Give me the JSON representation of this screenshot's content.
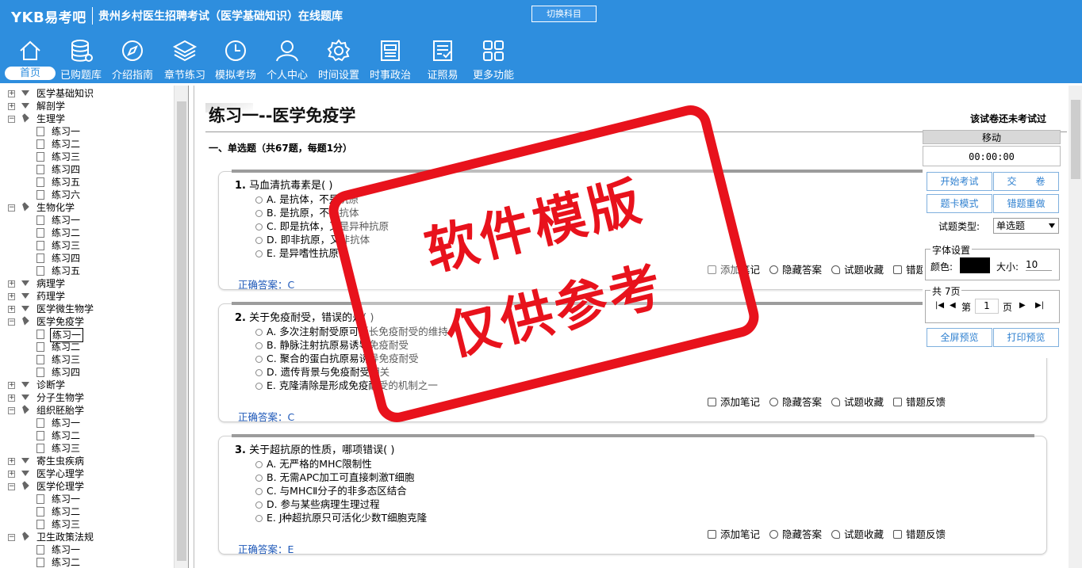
{
  "header": {
    "logo_prefix": "YKB",
    "logo_suffix": "易考吧",
    "title": "贵州乡村医生招聘考试（医学基础知识）在线题库",
    "switch_label": "切换科目"
  },
  "nav": [
    {
      "label": "首页",
      "icon": "home-icon"
    },
    {
      "label": "已购题库",
      "icon": "database-icon"
    },
    {
      "label": "介绍指南",
      "icon": "compass-icon"
    },
    {
      "label": "章节练习",
      "icon": "layers-icon"
    },
    {
      "label": "模拟考场",
      "icon": "clock-icon"
    },
    {
      "label": "个人中心",
      "icon": "user-icon"
    },
    {
      "label": "时间设置",
      "icon": "gear-icon"
    },
    {
      "label": "时事政治",
      "icon": "newspaper-icon"
    },
    {
      "label": "证照易",
      "icon": "checklist-icon"
    },
    {
      "label": "更多功能",
      "icon": "grid-icon"
    }
  ],
  "tree": [
    {
      "t": "医学基础知识",
      "type": "folder"
    },
    {
      "t": "解剖学",
      "type": "folder"
    },
    {
      "t": "生理学",
      "type": "open"
    },
    {
      "t": "练习一",
      "type": "leaf"
    },
    {
      "t": "练习二",
      "type": "leaf"
    },
    {
      "t": "练习三",
      "type": "leaf"
    },
    {
      "t": "练习四",
      "type": "leaf"
    },
    {
      "t": "练习五",
      "type": "leaf"
    },
    {
      "t": "练习六",
      "type": "leaf"
    },
    {
      "t": "生物化学",
      "type": "open"
    },
    {
      "t": "练习一",
      "type": "leaf"
    },
    {
      "t": "练习二",
      "type": "leaf"
    },
    {
      "t": "练习三",
      "type": "leaf"
    },
    {
      "t": "练习四",
      "type": "leaf"
    },
    {
      "t": "练习五",
      "type": "leaf"
    },
    {
      "t": "病理学",
      "type": "folder"
    },
    {
      "t": "药理学",
      "type": "folder"
    },
    {
      "t": "医学微生物学",
      "type": "folder"
    },
    {
      "t": "医学免疫学",
      "type": "open"
    },
    {
      "t": "练习一",
      "type": "sel"
    },
    {
      "t": "练习二",
      "type": "leaf"
    },
    {
      "t": "练习三",
      "type": "leaf"
    },
    {
      "t": "练习四",
      "type": "leaf"
    },
    {
      "t": "诊断学",
      "type": "folder"
    },
    {
      "t": "分子生物学",
      "type": "folder"
    },
    {
      "t": "组织胚胎学",
      "type": "open"
    },
    {
      "t": "练习一",
      "type": "leaf"
    },
    {
      "t": "练习二",
      "type": "leaf"
    },
    {
      "t": "练习三",
      "type": "leaf"
    },
    {
      "t": "寄生虫疾病",
      "type": "folder"
    },
    {
      "t": "医学心理学",
      "type": "folder"
    },
    {
      "t": "医学伦理学",
      "type": "open"
    },
    {
      "t": "练习一",
      "type": "leaf"
    },
    {
      "t": "练习二",
      "type": "leaf"
    },
    {
      "t": "练习三",
      "type": "leaf"
    },
    {
      "t": "卫生政策法规",
      "type": "open"
    },
    {
      "t": "练习一",
      "type": "leaf"
    },
    {
      "t": "练习二",
      "type": "leaf"
    }
  ],
  "paper": {
    "title": "练习一--医学免疫学",
    "status": "该试卷还未考试过",
    "section": "一、单选题（共67题，每题1分）"
  },
  "questions": [
    {
      "num": "1.",
      "stem": "马血清抗毒素是(  )",
      "options": [
        "A. 是抗体，不是抗原",
        "B. 是抗原，不是抗体",
        "C. 即是抗体，又是异种抗原",
        "D. 即非抗原，又非抗体",
        "E. 是异嗜性抗原"
      ],
      "answer": "正确答案：C"
    },
    {
      "num": "2.",
      "stem": "关于免疫耐受，错误的是(  )",
      "options": [
        "A. 多次注射耐受原可延长免疫耐受的维持",
        "B. 静脉注射抗原易诱导免疫耐受",
        "C. 聚合的蛋白抗原易诱导免疫耐受",
        "D. 遗传背景与免疫耐受相关",
        "E. 克隆清除是形成免疫耐受的机制之一"
      ],
      "answer": "正确答案：C"
    },
    {
      "num": "3.",
      "stem": "关于超抗原的性质，哪项错误(  )",
      "options": [
        "A. 无严格的MHC限制性",
        "B. 无需APC加工可直接刺激T细胞",
        "C. 与MHCⅡ分子的非多态区结合",
        "D. 参与某些病理生理过程",
        "E. J种超抗原只可活化少数T细胞克隆"
      ],
      "answer": "正确答案：E"
    }
  ],
  "tools": {
    "note": "添加笔记",
    "hide": "隐藏答案",
    "fav": "试题收藏",
    "report": "错题反馈"
  },
  "panel": {
    "move": "移动",
    "timer": "00:00:00",
    "start": "开始考试",
    "submit": "交　　卷",
    "card": "题卡模式",
    "redo": "错题重做",
    "type_label": "试题类型:",
    "type_value": "单选题",
    "font_legend": "字体设置",
    "color_label": "颜色:",
    "color_value": "#000000",
    "size_label": "大小:",
    "size_value": "10",
    "pages_legend": "共 7页",
    "page_prefix": "第",
    "page_value": "1",
    "page_suffix": "页",
    "preview": "全屏预览",
    "print": "打印预览"
  },
  "watermark": {
    "line1": "软件模版",
    "line2": "仅供参考"
  }
}
